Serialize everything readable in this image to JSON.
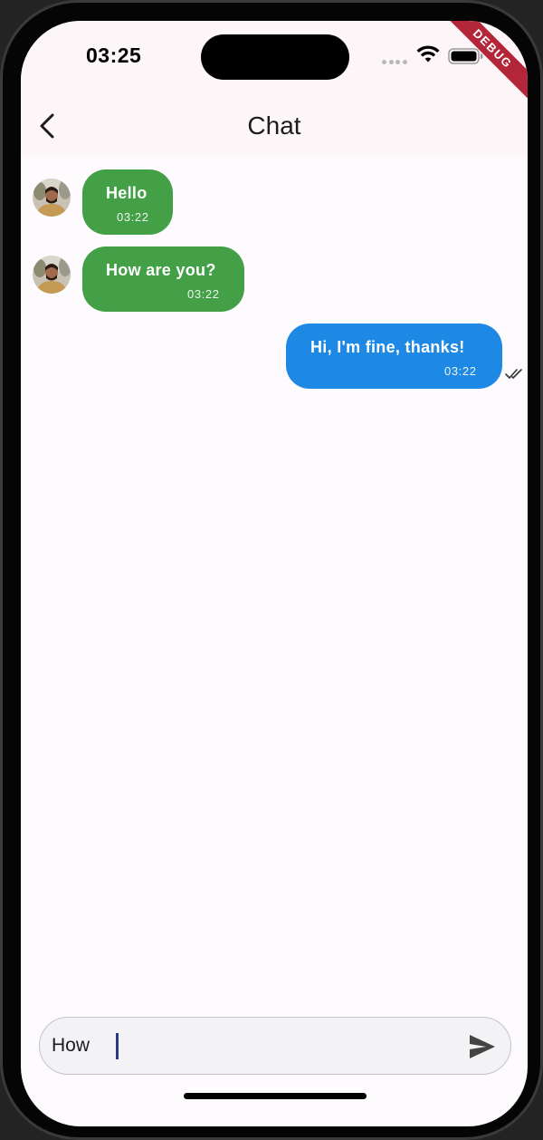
{
  "status_bar": {
    "time": "03:25",
    "debug_banner": "DEBUG",
    "icons": [
      "signal-dots-icon",
      "wifi-icon",
      "battery-icon"
    ]
  },
  "app_bar": {
    "title": "Chat",
    "back_icon": "chevron-left-icon"
  },
  "messages": [
    {
      "text": "Hello",
      "time": "03:22",
      "direction": "incoming",
      "color": "#43a047",
      "avatar": "avatar-icon"
    },
    {
      "text": "How are you?",
      "time": "03:22",
      "direction": "incoming",
      "color": "#43a047",
      "avatar": "avatar-icon"
    },
    {
      "text": "Hi, I'm fine, thanks!",
      "time": "03:22",
      "direction": "outgoing",
      "color": "#1e88e5",
      "status_icon": "double-check-icon"
    }
  ],
  "composer": {
    "value": "How",
    "send_icon": "send-icon"
  },
  "colors": {
    "incoming_bubble": "#43a047",
    "outgoing_bubble": "#1e88e5",
    "app_bar_bg": "#fdf6f9",
    "screen_bg": "#fdfbfe",
    "debug_ribbon": "#b3263a"
  }
}
